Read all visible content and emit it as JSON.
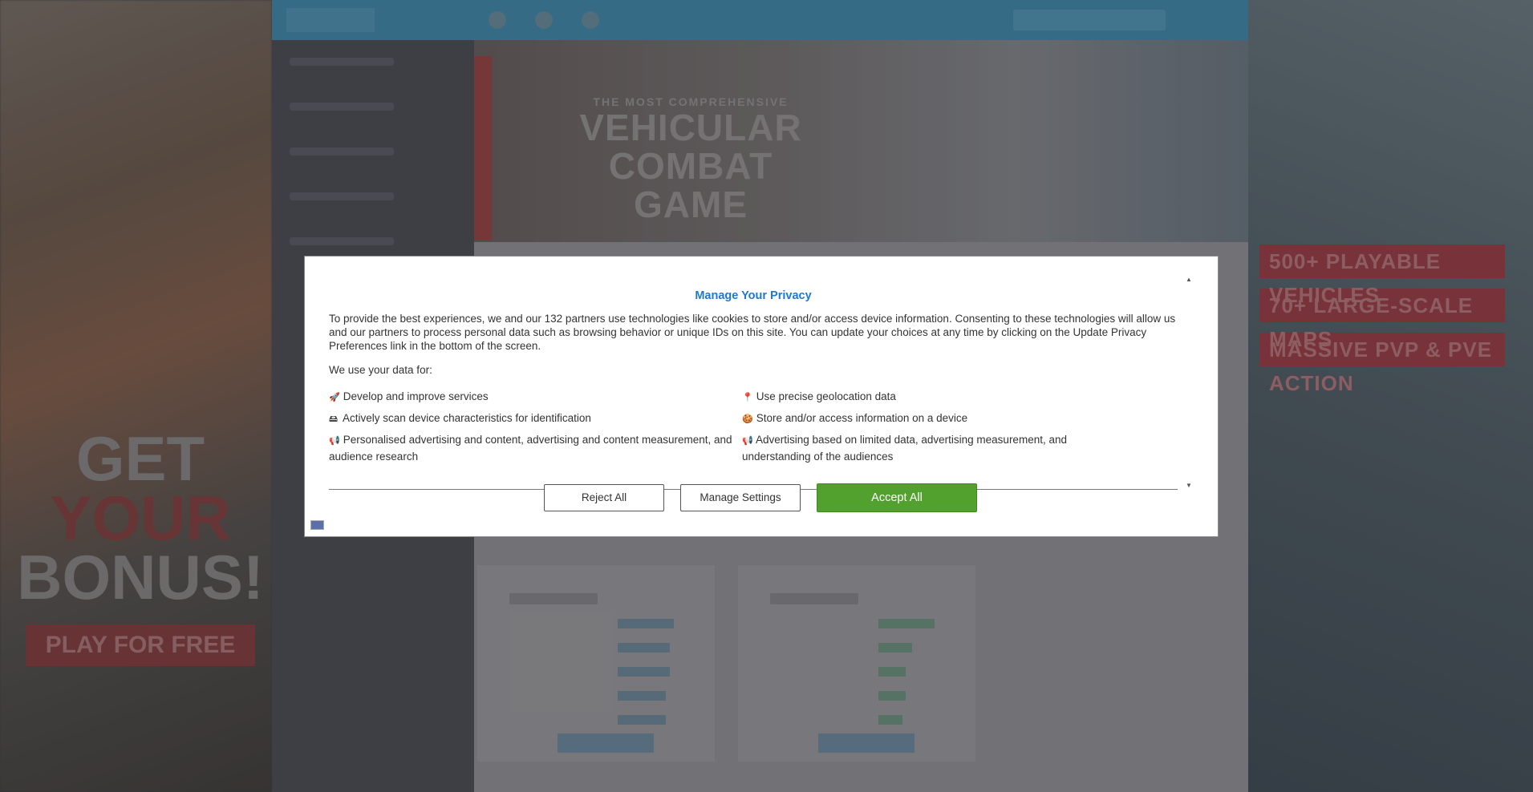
{
  "background": {
    "hero": {
      "subtitle": "THE MOST COMPREHENSIVE",
      "title_line1": "VEHICULAR",
      "title_line2": "COMBAT GAME"
    },
    "right_promo": [
      "500+ PLAYABLE VEHICLES",
      "70+ LARGE-SCALE MAPS",
      "MASSIVE PVP & PVE ACTION"
    ],
    "left_promo": {
      "get": "GET",
      "your": "YOUR",
      "bonus": "BONUS!",
      "play": "PLAY FOR FREE"
    }
  },
  "consent": {
    "title": "Manage Your Privacy",
    "intro": "To provide the best experiences, we and our 132 partners use technologies like cookies to store and/or access device information. Consenting to these technologies will allow us and our partners to process personal data such as browsing behavior or unique IDs on this site. You can update your choices at any time by clicking on the Update Privacy Preferences link in the bottom of the screen.",
    "use_heading": "We use your data for:",
    "purposes": [
      {
        "icon": "rocket-icon",
        "glyph": "🚀",
        "label": "Develop and improve services"
      },
      {
        "icon": "location-pin-icon",
        "glyph": "📍",
        "label": "Use precise geolocation data"
      },
      {
        "icon": "device-scan-icon",
        "glyph": "🖴",
        "label": "Actively scan device characteristics for identification"
      },
      {
        "icon": "cookie-icon",
        "glyph": "🍪",
        "label": "Store and/or access information on a device"
      },
      {
        "icon": "megaphone-icon",
        "glyph": "📢",
        "label": "Personalised advertising and content, advertising and content measurement, and audience research"
      },
      {
        "icon": "megaphone-icon",
        "glyph": "📢",
        "label": "Advertising based on limited data, advertising measurement, and understanding of the audiences"
      }
    ],
    "buttons": {
      "reject": "Reject All",
      "manage": "Manage Settings",
      "accept": "Accept All"
    },
    "colors": {
      "title": "#1e78d2",
      "accept": "#52a12e"
    }
  }
}
